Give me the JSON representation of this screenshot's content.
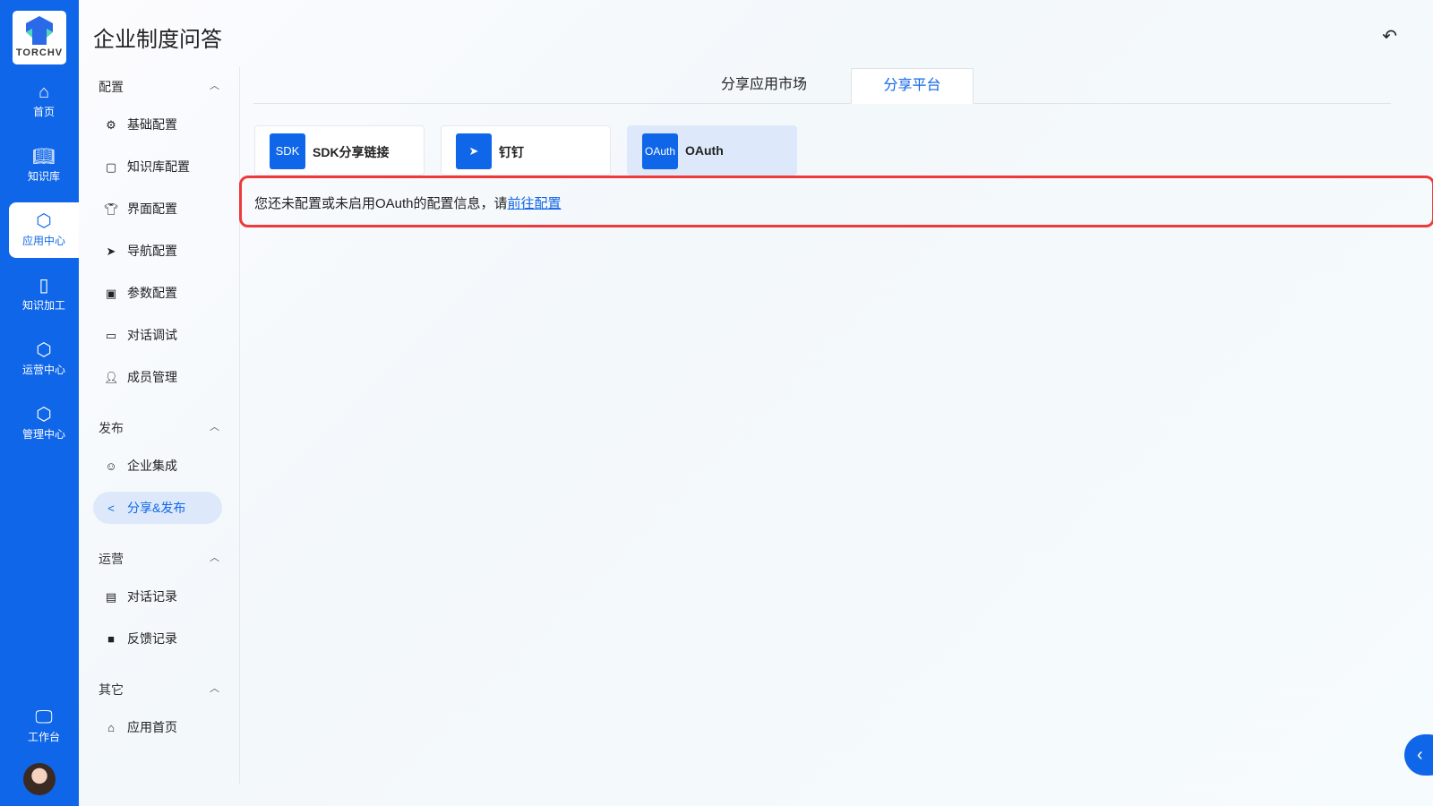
{
  "logo": {
    "text": "TORCHV"
  },
  "rail": [
    {
      "label": "首页",
      "icon": "home-icon"
    },
    {
      "label": "知识库",
      "icon": "book-icon"
    },
    {
      "label": "应用中心",
      "icon": "app-center-icon"
    },
    {
      "label": "知识加工",
      "icon": "knowledge-process-icon"
    },
    {
      "label": "运营中心",
      "icon": "operation-icon"
    },
    {
      "label": "管理中心",
      "icon": "settings-icon"
    }
  ],
  "workbench": "工作台",
  "title": "企业制度问答",
  "sections": {
    "config": "配置",
    "publish": "发布",
    "ops": "运营",
    "other": "其它"
  },
  "menu": {
    "basic": "基础配置",
    "kb": "知识库配置",
    "ui": "界面配置",
    "nav": "导航配置",
    "params": "参数配置",
    "debug": "对话调试",
    "members": "成员管理",
    "enterprise": "企业集成",
    "share": "分享&发布",
    "chatlog": "对话记录",
    "feedback": "反馈记录",
    "home": "应用首页"
  },
  "tabs": [
    "分享应用市场",
    "分享平台"
  ],
  "cards": [
    {
      "icon_text": "SDK",
      "label": "SDK分享链接"
    },
    {
      "icon_text": "",
      "label": "钉钉"
    },
    {
      "icon_text": "OAuth",
      "label": "OAuth"
    }
  ],
  "alert": {
    "text": "您还未配置或未启用OAuth的配置信息，请",
    "link": "前往配置"
  }
}
